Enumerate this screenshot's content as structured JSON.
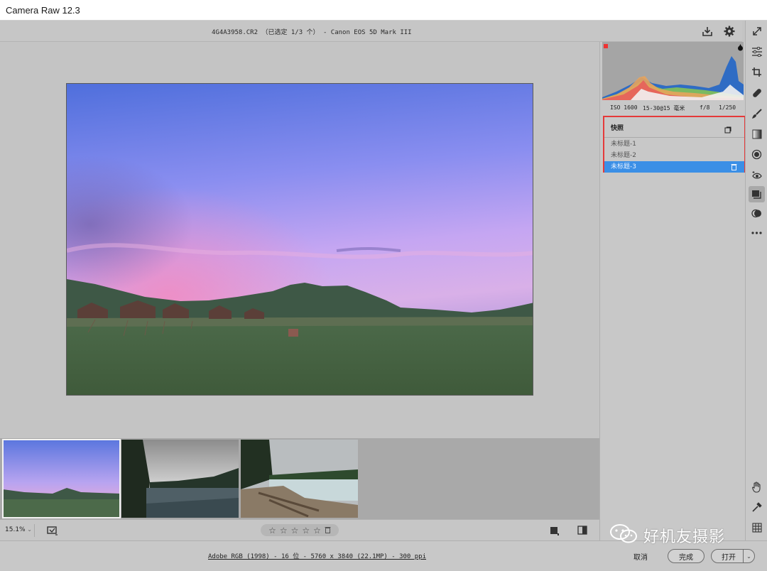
{
  "window": {
    "title": "Camera Raw 12.3"
  },
  "topbar": {
    "file_info": "4G4A3958.CR2  （已选定 1/3 个）  -  Canon EOS 5D Mark III"
  },
  "exif": {
    "iso": "ISO 1600",
    "lens": "15-30@15 毫米",
    "aperture": "f/8",
    "shutter": "1/250"
  },
  "snapshots": {
    "label": "快照",
    "items": [
      {
        "label": "未标题-1",
        "selected": false
      },
      {
        "label": "未标题-2",
        "selected": false
      },
      {
        "label": "未标题-3",
        "selected": true
      }
    ]
  },
  "bottombar": {
    "zoom": "15.1%",
    "stars": [
      "☆",
      "☆",
      "☆",
      "☆",
      "☆"
    ]
  },
  "footer": {
    "workflow": "Adobe RGB (1998) - 16 位 - 5760 x 3840 (22.1MP) - 300 ppi",
    "cancel": "取消",
    "done": "完成",
    "open": "打开"
  },
  "watermark": {
    "text": "好机友摄影"
  },
  "thumbnails": [
    {
      "name": "twilight-village",
      "selected": true
    },
    {
      "name": "river-forest",
      "selected": false
    },
    {
      "name": "lake-shore",
      "selected": false
    }
  ],
  "colors": {
    "accent": "#3b8fe6",
    "highlight_border": "#e53a3a"
  },
  "icons": {
    "topbar": [
      "save-icon",
      "gear-icon",
      "fullscreen-icon"
    ],
    "tools": [
      "edit-sliders-icon",
      "crop-icon",
      "healing-icon",
      "brush-icon",
      "gradient-icon",
      "radial-filter-icon",
      "red-eye-icon",
      "snapshots-icon",
      "presets-icon",
      "more-icon",
      "hand-icon",
      "eyedropper-icon",
      "grid-icon"
    ]
  }
}
